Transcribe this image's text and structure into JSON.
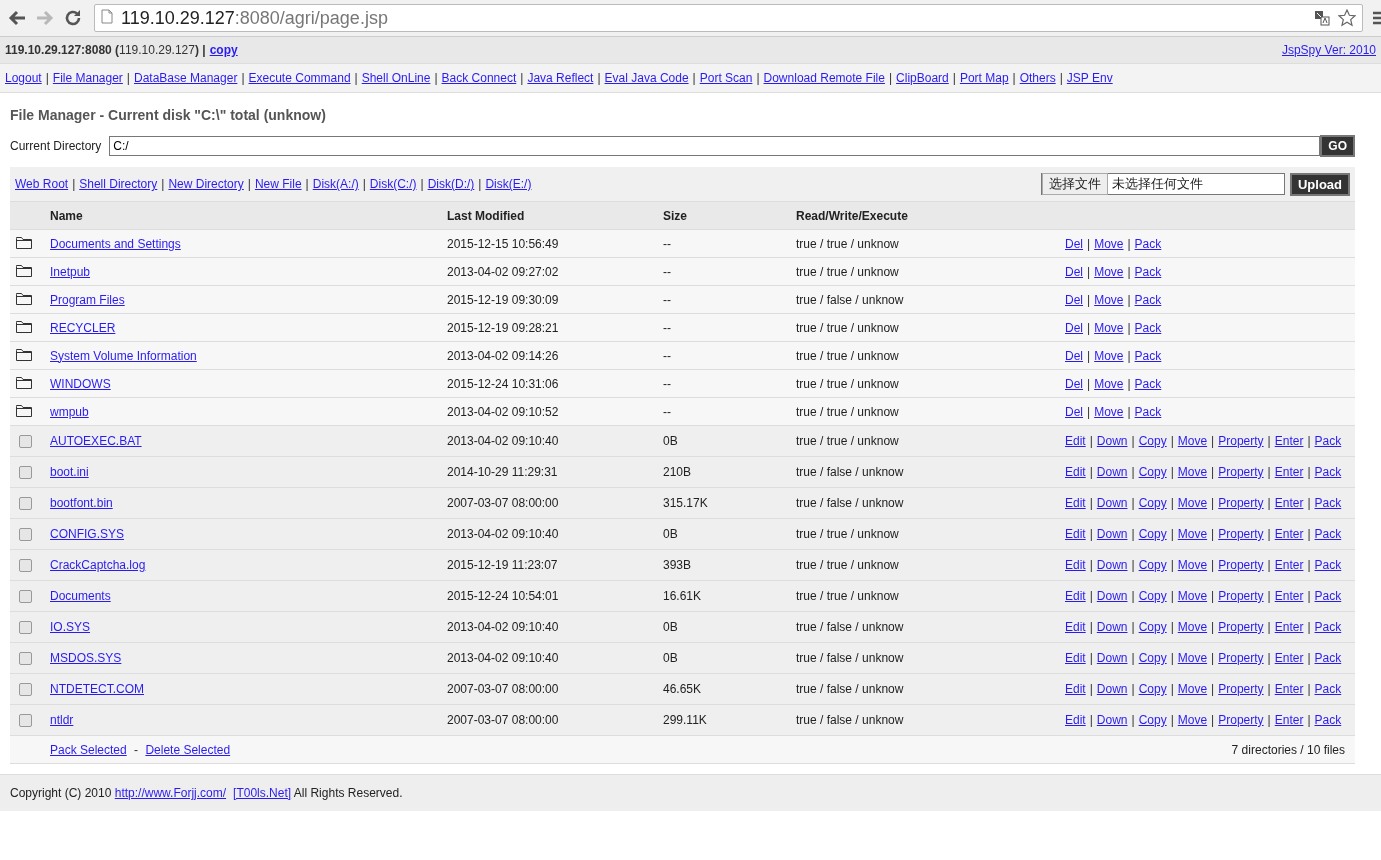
{
  "browser": {
    "nav_buttons": [
      {
        "kind": "back",
        "disabled": false
      },
      {
        "kind": "forward",
        "disabled": true
      },
      {
        "kind": "reload",
        "disabled": false
      }
    ],
    "url": {
      "host": "119.10.29.127",
      "rest": ":8080/agri/page.jsp"
    }
  },
  "header": {
    "server": "**119.10.29.127:8080 (**119.10.29.127**) |**",
    "copy_link": "copy",
    "version_link": "JspSpy Ver: 2010"
  },
  "menu": {
    "separator": "|",
    "links": [
      "Logout",
      "File Manager",
      "DataBase Manager",
      "Execute Command",
      "Shell OnLine",
      "Back Connect",
      "Java Reflect",
      "Eval Java Code",
      "Port Scan",
      "Download Remote File",
      "ClipBoard",
      "Port Map",
      "Others",
      "JSP Env"
    ]
  },
  "title": "File Manager - Current disk \"C:\\\" total (unknow)",
  "directory": {
    "label": "Current Directory",
    "value": "C:/",
    "button": "GO"
  },
  "toolbar": {
    "links": [
      "Web Root",
      "Shell Directory",
      "New Directory",
      "New File",
      "Disk(A:/)",
      "Disk(C:/)",
      "Disk(D:/)",
      "Disk(E:/)"
    ],
    "choose_button": "选择文件",
    "no_file": "未选择任何文件",
    "upload_button": "Upload"
  },
  "table": {
    "columns": [
      "Name",
      "Last Modified",
      "Size",
      "Read/Write/Execute"
    ],
    "rows": [
      {
        "kind": "dir",
        "name": "Documents and Settings",
        "modified": "2015-12-15 10:56:49",
        "size": "--",
        "rwx": "true / true / unknow",
        "actions": [
          "Del",
          "Move",
          "Pack"
        ]
      },
      {
        "kind": "dir",
        "name": "Inetpub",
        "modified": "2013-04-02 09:27:02",
        "size": "--",
        "rwx": "true / true / unknow",
        "actions": [
          "Del",
          "Move",
          "Pack"
        ]
      },
      {
        "kind": "dir",
        "name": "Program Files",
        "modified": "2015-12-19 09:30:09",
        "size": "--",
        "rwx": "true / false / unknow",
        "actions": [
          "Del",
          "Move",
          "Pack"
        ]
      },
      {
        "kind": "dir",
        "name": "RECYCLER",
        "modified": "2015-12-19 09:28:21",
        "size": "--",
        "rwx": "true / true / unknow",
        "actions": [
          "Del",
          "Move",
          "Pack"
        ]
      },
      {
        "kind": "dir",
        "name": "System Volume Information",
        "modified": "2013-04-02 09:14:26",
        "size": "--",
        "rwx": "true / true / unknow",
        "actions": [
          "Del",
          "Move",
          "Pack"
        ]
      },
      {
        "kind": "dir",
        "name": "WINDOWS",
        "modified": "2015-12-24 10:31:06",
        "size": "--",
        "rwx": "true / true / unknow",
        "actions": [
          "Del",
          "Move",
          "Pack"
        ]
      },
      {
        "kind": "dir",
        "name": "wmpub",
        "modified": "2013-04-02 09:10:52",
        "size": "--",
        "rwx": "true / true / unknow",
        "actions": [
          "Del",
          "Move",
          "Pack"
        ]
      },
      {
        "kind": "file",
        "checked": false,
        "name": "AUTOEXEC.BAT",
        "modified": "2013-04-02 09:10:40",
        "size": "0B",
        "rwx": "true / true / unknow",
        "actions": [
          "Edit",
          "Down",
          "Copy",
          "Move",
          "Property",
          "Enter",
          "Pack"
        ]
      },
      {
        "kind": "file",
        "checked": false,
        "name": "boot.ini",
        "modified": "2014-10-29 11:29:31",
        "size": "210B",
        "rwx": "true / false / unknow",
        "actions": [
          "Edit",
          "Down",
          "Copy",
          "Move",
          "Property",
          "Enter",
          "Pack"
        ]
      },
      {
        "kind": "file",
        "checked": false,
        "name": "bootfont.bin",
        "modified": "2007-03-07 08:00:00",
        "size": "315.17K",
        "rwx": "true / false / unknow",
        "actions": [
          "Edit",
          "Down",
          "Copy",
          "Move",
          "Property",
          "Enter",
          "Pack"
        ]
      },
      {
        "kind": "file",
        "checked": false,
        "name": "CONFIG.SYS",
        "modified": "2013-04-02 09:10:40",
        "size": "0B",
        "rwx": "true / true / unknow",
        "actions": [
          "Edit",
          "Down",
          "Copy",
          "Move",
          "Property",
          "Enter",
          "Pack"
        ]
      },
      {
        "kind": "file",
        "checked": false,
        "name": "CrackCaptcha.log",
        "modified": "2015-12-19 11:23:07",
        "size": "393B",
        "rwx": "true / true / unknow",
        "actions": [
          "Edit",
          "Down",
          "Copy",
          "Move",
          "Property",
          "Enter",
          "Pack"
        ]
      },
      {
        "kind": "file",
        "checked": false,
        "name": "Documents",
        "modified": "2015-12-24 10:54:01",
        "size": "16.61K",
        "rwx": "true / true / unknow",
        "actions": [
          "Edit",
          "Down",
          "Copy",
          "Move",
          "Property",
          "Enter",
          "Pack"
        ]
      },
      {
        "kind": "file",
        "checked": false,
        "name": "IO.SYS",
        "modified": "2013-04-02 09:10:40",
        "size": "0B",
        "rwx": "true / false / unknow",
        "actions": [
          "Edit",
          "Down",
          "Copy",
          "Move",
          "Property",
          "Enter",
          "Pack"
        ]
      },
      {
        "kind": "file",
        "checked": false,
        "name": "MSDOS.SYS",
        "modified": "2013-04-02 09:10:40",
        "size": "0B",
        "rwx": "true / false / unknow",
        "actions": [
          "Edit",
          "Down",
          "Copy",
          "Move",
          "Property",
          "Enter",
          "Pack"
        ]
      },
      {
        "kind": "file",
        "checked": false,
        "name": "NTDETECT.COM",
        "modified": "2007-03-07 08:00:00",
        "size": "46.65K",
        "rwx": "true / false / unknow",
        "actions": [
          "Edit",
          "Down",
          "Copy",
          "Move",
          "Property",
          "Enter",
          "Pack"
        ]
      },
      {
        "kind": "file",
        "checked": false,
        "name": "ntldr",
        "modified": "2007-03-07 08:00:00",
        "size": "299.11K",
        "rwx": "true / false / unknow",
        "actions": [
          "Edit",
          "Down",
          "Copy",
          "Move",
          "Property",
          "Enter",
          "Pack"
        ]
      }
    ],
    "action_separator": "|",
    "footer": {
      "pack_link": "Pack Selected",
      "dash": "-",
      "delete_link": "Delete Selected",
      "summary": "7 directories / 10 files"
    }
  },
  "copyright": [
    {
      "kind": "text",
      "text": "Copyright (C) 2010 "
    },
    {
      "kind": "link",
      "text": "http://www.Forjj.com/"
    },
    {
      "kind": "link",
      "text": "[T00ls.Net]"
    },
    {
      "kind": "text",
      "text": " All Rights Reserved."
    }
  ]
}
